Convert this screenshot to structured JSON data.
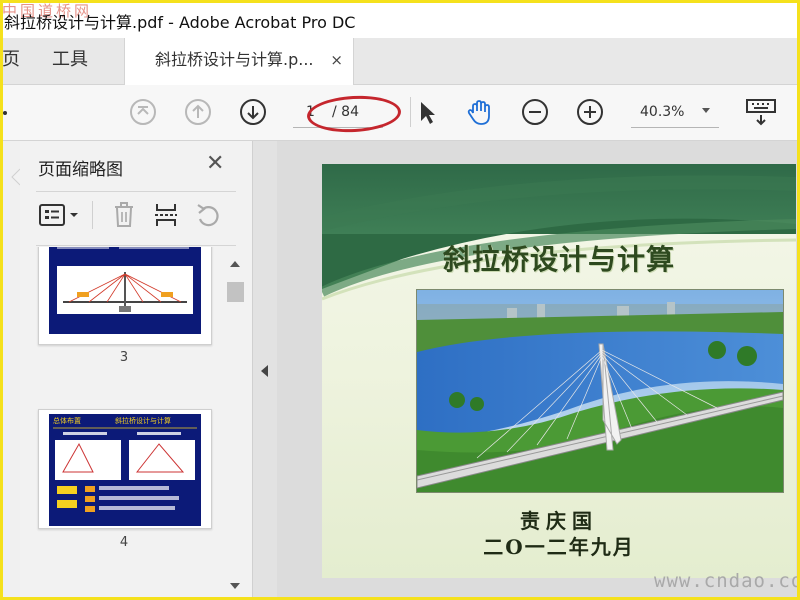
{
  "window": {
    "title": "斜拉桥设计与计算.pdf - Adobe Acrobat Pro DC",
    "watermark_top_left": "中国道桥网"
  },
  "tabs": {
    "home": "页",
    "tools": "工具",
    "document": "斜拉桥设计与计算.p...",
    "close_symbol": "×"
  },
  "toolbar": {
    "icons": [
      "first-page-icon",
      "previous-page-icon",
      "next-page-icon",
      "select-arrow-icon",
      "hand-icon",
      "zoom-out-icon",
      "zoom-in-icon",
      "keyboard-icon"
    ],
    "page_current": "1",
    "page_total": "/ 84",
    "zoom": "40.3%"
  },
  "panel": {
    "title": "页面缩略图",
    "close_symbol": "✕",
    "thumbnails": [
      {
        "label": "3"
      },
      {
        "label": "4",
        "header": "斜拉桥设计与计算",
        "section": "总体布置"
      }
    ]
  },
  "slide": {
    "title": "斜拉桥设计与计算",
    "author": "责庆国",
    "date": "二O一二年九月"
  },
  "watermark_bottom_right": "www.cndao.com",
  "colors": {
    "accent_blue": "#1f6fd6",
    "annotation_red": "#c5262d",
    "slide_green_dark": "#2e5a3a"
  }
}
